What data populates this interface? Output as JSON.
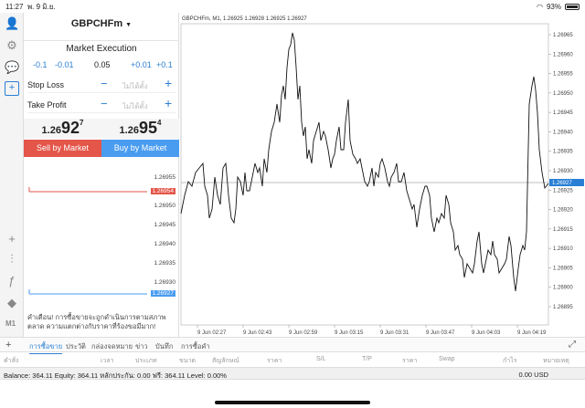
{
  "status": {
    "time": "11:27",
    "date": "พ. 9 มิ.ย.",
    "battery": "93%"
  },
  "order": {
    "symbol": "GBPCHFm",
    "mode": "Market Execution",
    "volume_steps": [
      "-0.1",
      "-0.01",
      "0.05",
      "+0.01",
      "+0.1"
    ],
    "stop_loss_label": "Stop Loss",
    "take_profit_label": "Take Profit",
    "not_set": "ไม่ได้ตั้ง",
    "bid": {
      "small": "1.26",
      "big": "92",
      "sup": "7"
    },
    "ask": {
      "small": "1.26",
      "big": "95",
      "sup": "4"
    },
    "sell_label": "Sell by Market",
    "buy_label": "Buy by Market",
    "mini_prices": [
      "1.26955",
      "1.26950",
      "1.26945",
      "1.26940",
      "1.26935",
      "1.26930",
      "1.26925"
    ],
    "ask_tag": "1.26954",
    "bid_tag": "1.26927",
    "warning": "คำเตือน! การซื้อขายจะถูกดำเนินการตามสภาพตลาด ความแตกต่างกับราคาที่ร้องขอมีมาก!"
  },
  "rail": {
    "timeframe": "M1"
  },
  "chart": {
    "header": "GBPCHFm, M1, 1.26925 1.26928 1.26925 1.26927",
    "price_labels": [
      "1.26965",
      "1.26960",
      "1.26955",
      "1.26950",
      "1.26945",
      "1.26940",
      "1.26935",
      "1.26930",
      "1.26925",
      "1.26920",
      "1.26915",
      "1.26910",
      "1.26905",
      "1.26900",
      "1.26895"
    ],
    "current_price": "1.26927",
    "time_labels": [
      "9 Jun 02:27",
      "9 Jun 02:43",
      "9 Jun 02:59",
      "9 Jun 03:15",
      "9 Jun 03:31",
      "9 Jun 03:47",
      "9 Jun 04:03",
      "9 Jun 04:19"
    ],
    "line_color": "#111111"
  },
  "tabs": [
    "การซื้อขาย",
    "ประวัติ",
    "กล่องจดหมาย",
    "ข่าว",
    "บันทึก",
    "การซื้อคำ"
  ],
  "columns": [
    "คำสั่ง",
    "เวลา",
    "ประเภท",
    "ขนาด",
    "สัญลักษณ์",
    "ราคา",
    "S/L",
    "T/P",
    "ราคา",
    "Swap",
    "กำไร",
    "หมายเหตุ"
  ],
  "balance": {
    "summary": "Balance: 364.11 Equity: 364.11 หลักประกัน: 0.00 ฟรี: 364.11 Level: 0.00%",
    "profit": "0.00 USD"
  }
}
